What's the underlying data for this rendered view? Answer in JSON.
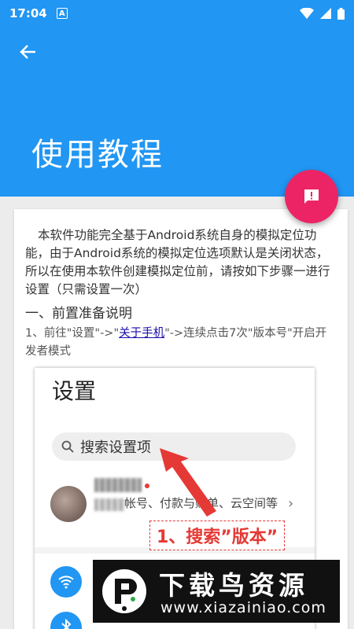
{
  "status_bar": {
    "time": "17:04",
    "notification_icon_letter": "A"
  },
  "app_bar": {
    "title": "使用教程"
  },
  "content": {
    "intro": "本软件功能完全基于Android系统自身的模拟定位功能，由于Android系统的模拟定位选项默认是关闭状态，所以在使用本软件创建模拟定位前，请按如下步骤一进行设置（只需设置一次）",
    "section_heading": "一、前置准备说明",
    "step1_prefix": "1、前往\"设置\"->\"",
    "step1_link": "关于手机",
    "step1_suffix": "\"->连续点击7次\"版本号\"开启开发者模式"
  },
  "screenshot": {
    "title": "设置",
    "search_placeholder": "搜索设置项",
    "account_subtitle": "帐号、付款与账单、云空间等",
    "annotation": "1、搜索”版本”"
  },
  "watermark": {
    "title": "下载鸟资源",
    "url": "www.xiazainiao.com"
  },
  "colors": {
    "primary": "#2196f3",
    "fab": "#ec2466",
    "annotation": "#e53935"
  }
}
